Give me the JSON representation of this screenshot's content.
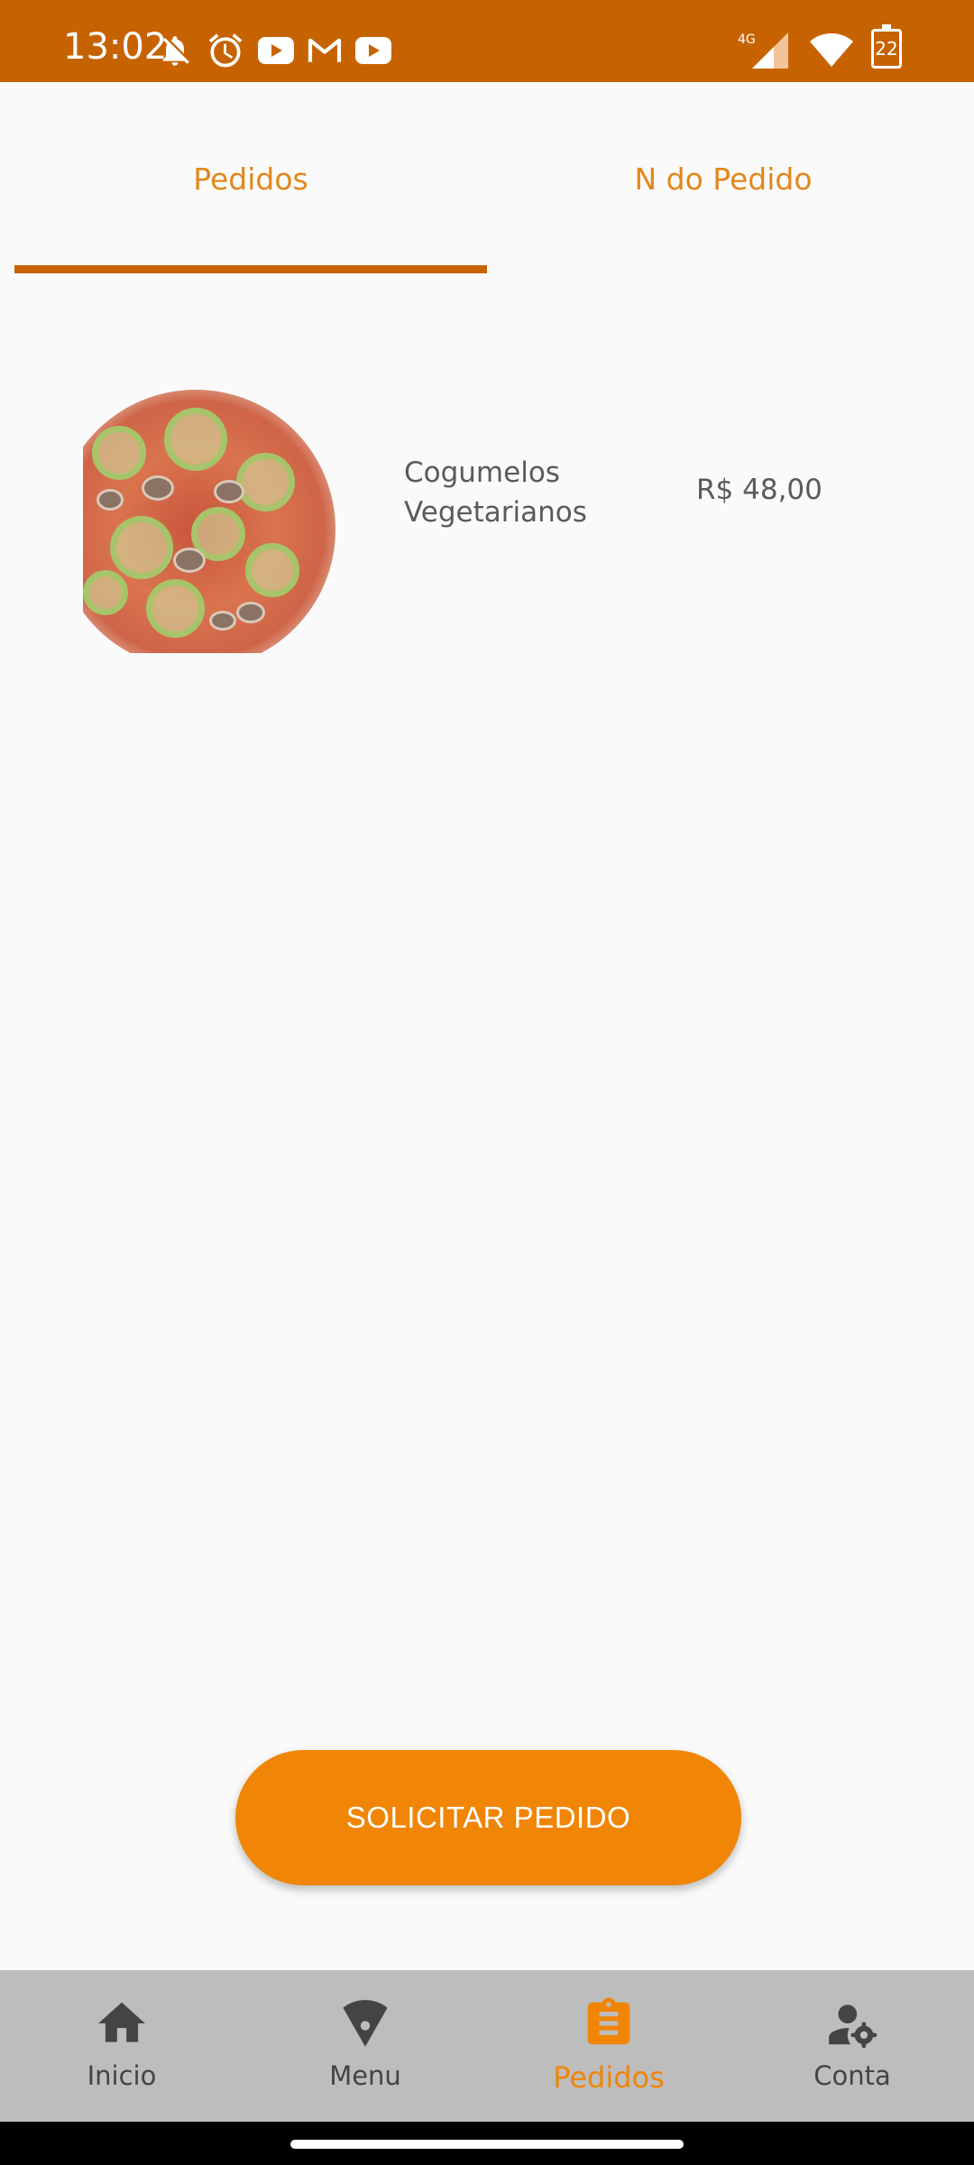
{
  "status_bar": {
    "time": "13:02",
    "network": "4G",
    "battery": "22",
    "icons_left": [
      "bell-off-icon",
      "alarm-icon",
      "youtube-icon",
      "gmail-icon",
      "youtube-icon"
    ],
    "icons_right": [
      "signal-icon",
      "wifi-icon",
      "battery-icon"
    ]
  },
  "tabs": [
    {
      "label": "Pedidos",
      "selected": true
    },
    {
      "label": "N do Pedido",
      "selected": false
    }
  ],
  "order_items": [
    {
      "name": "Cogumelos Vegetarianos",
      "price": "R$ 48,00",
      "image": "pizza-image"
    }
  ],
  "actions": {
    "submit_label": "SOLICITAR PEDIDO"
  },
  "bottom_nav": [
    {
      "label": "Inicio",
      "icon": "home-icon",
      "active": false
    },
    {
      "label": "Menu",
      "icon": "pizza-slice-icon",
      "active": false
    },
    {
      "label": "Pedidos",
      "icon": "clipboard-icon",
      "active": true
    },
    {
      "label": "Conta",
      "icon": "user-settings-icon",
      "active": false
    }
  ],
  "colors": {
    "primary_dark": "#c66300",
    "accent": "#f08506",
    "tab_text": "#e3871b",
    "nav_background": "#bdbdbd"
  }
}
